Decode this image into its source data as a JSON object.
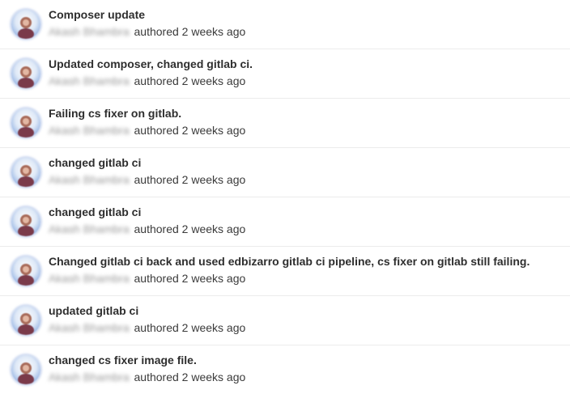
{
  "commits": [
    {
      "title": "Composer update",
      "author": "Akash Bhambra",
      "authored_label": "authored",
      "time": "2 weeks ago"
    },
    {
      "title": "Updated composer, changed gitlab ci.",
      "author": "Akash Bhambra",
      "authored_label": "authored",
      "time": "2 weeks ago"
    },
    {
      "title": "Failing cs fixer on gitlab.",
      "author": "Akash Bhambra",
      "authored_label": "authored",
      "time": "2 weeks ago"
    },
    {
      "title": "changed gitlab ci",
      "author": "Akash Bhambra",
      "authored_label": "authored",
      "time": "2 weeks ago"
    },
    {
      "title": "changed gitlab ci",
      "author": "Akash Bhambra",
      "authored_label": "authored",
      "time": "2 weeks ago"
    },
    {
      "title": "Changed gitlab ci back and used edbizarro gitlab ci pipeline, cs fixer on gitlab still failing.",
      "author": "Akash Bhambra",
      "authored_label": "authored",
      "time": "2 weeks ago"
    },
    {
      "title": "updated gitlab ci",
      "author": "Akash Bhambra",
      "authored_label": "authored",
      "time": "2 weeks ago"
    },
    {
      "title": "changed cs fixer image file.",
      "author": "Akash Bhambra",
      "authored_label": "authored",
      "time": "2 weeks ago"
    }
  ],
  "avatar_icon": "user-avatar-icon",
  "colors": {
    "title": "#2e2e2e",
    "meta": "#3a3a3a",
    "divider": "#ececec",
    "avatar_ring": "#6f95d6"
  }
}
